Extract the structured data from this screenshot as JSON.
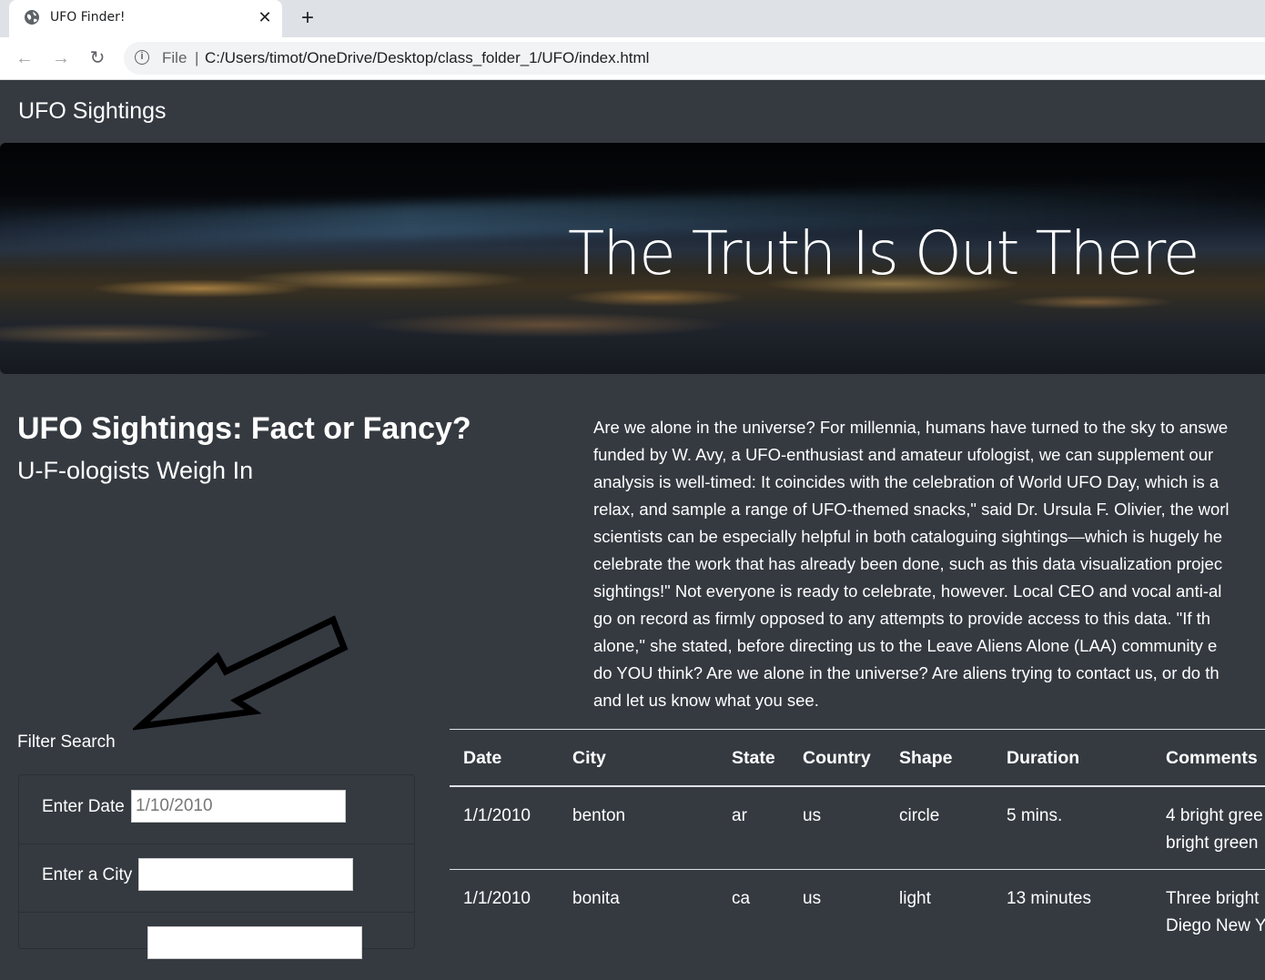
{
  "browser": {
    "tab_title": "UFO Finder!",
    "close_glyph": "✕",
    "new_tab_glyph": "+",
    "back_glyph": "←",
    "forward_glyph": "→",
    "reload_glyph": "↻",
    "info_glyph": "i",
    "scheme_label": "File",
    "separator": "|",
    "url": "C:/Users/timot/OneDrive/Desktop/class_folder_1/UFO/index.html"
  },
  "navbar": {
    "brand": "UFO Sightings"
  },
  "hero": {
    "title": "The Truth Is Out There"
  },
  "intro": {
    "title": "UFO Sightings: Fact or Fancy?",
    "subtitle": "U-F-ologists Weigh In"
  },
  "article": {
    "lines": [
      "Are we alone in the universe? For millennia, humans have turned to the sky to answe",
      "funded by W. Avy, a UFO-enthusiast and amateur ufologist, we can supplement our",
      "analysis is well-timed: It coincides with the celebration of World UFO Day, which is a",
      "relax, and sample a range of UFO-themed snacks,\" said Dr. Ursula F. Olivier, the worl",
      "scientists can be especially helpful in both cataloguing sightings—which is hugely he",
      "celebrate the work that has already been done, such as this data visualization projec",
      "sightings!\" Not everyone is ready to celebrate, however. Local CEO and vocal anti-al",
      "go on record as firmly opposed to any attempts to provide access to this data. \"If th",
      "alone,\" she stated, before directing us to the Leave Aliens Alone (LAA) community e",
      "do YOU think? Are we alone in the universe? Are aliens trying to contact us, or do th",
      "and let us know what you see."
    ]
  },
  "filters": {
    "heading": "Filter Search",
    "date_label": "Enter Date",
    "date_placeholder": "1/10/2010",
    "city_label": "Enter a City",
    "city_value": ""
  },
  "table": {
    "headers": [
      "Date",
      "City",
      "State",
      "Country",
      "Shape",
      "Duration",
      "Comments"
    ],
    "rows": [
      {
        "date": "1/1/2010",
        "city": "benton",
        "state": "ar",
        "country": "us",
        "shape": "circle",
        "duration": "5 mins.",
        "comments_line1": "4 bright gree",
        "comments_line2": "bright green"
      },
      {
        "date": "1/1/2010",
        "city": "bonita",
        "state": "ca",
        "country": "us",
        "shape": "light",
        "duration": "13 minutes",
        "comments_line1": "Three bright",
        "comments_line2": "Diego New Y"
      }
    ]
  }
}
